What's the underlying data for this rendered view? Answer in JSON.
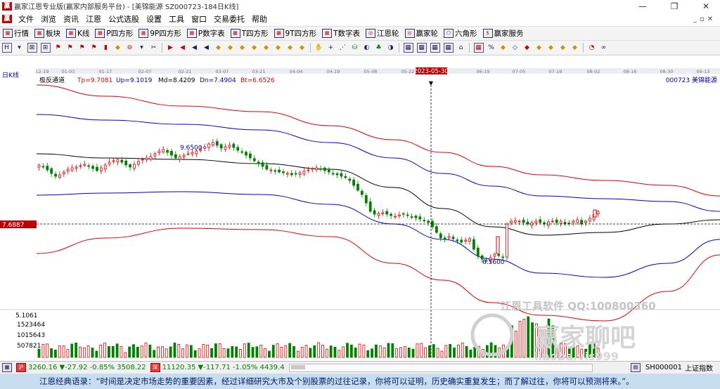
{
  "window": {
    "title": "赢家江恩专业版(赢家内部服务平台) - [美锦能源  SZ000723-184日K线]",
    "logo": "赢"
  },
  "menu": {
    "logo": "赢",
    "items": [
      "文件",
      "浏览",
      "资讯",
      "江恩",
      "公式选股",
      "设置",
      "工具",
      "窗口",
      "交易委托",
      "帮助"
    ]
  },
  "toolbar1": {
    "items": [
      {
        "label": "行情",
        "icon": "grid-icon"
      },
      {
        "label": "板块",
        "icon": "grid-icon"
      },
      {
        "label": "K线",
        "icon": "candle-icon"
      },
      {
        "label": "P四方形",
        "icon": "square-icon"
      },
      {
        "label": "9P四方形",
        "icon": "square-icon"
      },
      {
        "label": "P数字表",
        "icon": "square-icon"
      },
      {
        "label": "T四方形",
        "icon": "square-icon"
      },
      {
        "label": "9T四方形",
        "icon": "square-icon"
      },
      {
        "label": "T数字表",
        "icon": "square-icon"
      },
      {
        "label": "江恩轮",
        "icon": "wheel-icon"
      },
      {
        "label": "赢家轮",
        "icon": "wheel-icon"
      },
      {
        "label": "六角形",
        "icon": "hexagon-icon"
      },
      {
        "label": "赢家服务",
        "icon": "dollar-icon"
      }
    ]
  },
  "chart": {
    "period_label": "日K线",
    "indicator_name": "极反通道",
    "indicator_values": [
      {
        "label": "Tp=9.7081",
        "color": "#e00000"
      },
      {
        "label": "Up=9.1019",
        "color": "#0000d0"
      },
      {
        "label": "Md=8.4209",
        "color": "#000000"
      },
      {
        "label": "Dn=7.4904",
        "color": "#0000d0"
      },
      {
        "label": "Bt=6.6526",
        "color": "#e00000"
      }
    ],
    "stock": "000723 美锦能源",
    "date_ticks": [
      "12-19",
      "01-03",
      "01-17",
      "02-07",
      "02-21",
      "03-07",
      "03-21",
      "04-04",
      "04-19",
      "05-08",
      "05-22",
      "06-05",
      "06-19",
      "07-05",
      "07-19",
      "08-02",
      "08-16",
      "08-30",
      "09-13"
    ],
    "cursor_date": "2023-05-30",
    "cursor_price": "7.6887",
    "high_label": "9.6500",
    "low_label": "6.5600",
    "vol_top_label": "5.1061",
    "vol_labels": [
      "1523464",
      "1015643",
      "507821"
    ],
    "watermark_line": "江恩工具软件 QQ:100800360",
    "watermark_brand": "赢家聊吧",
    "watermark_url": "liaoba.yjs999"
  },
  "status": {
    "sh_index": "3260.16",
    "sh_change": "▼-27.92",
    "sh_pct": "-0.85%",
    "sh_amount": "3508.22",
    "sz_index": "11120.35",
    "sz_change": "▼-117.71",
    "sz_pct": "-1.05%",
    "sz_amount": "4439.4",
    "right_code": "SH000001",
    "right_name": "上证指数"
  },
  "ticker": {
    "text": "江恩经典语录：“时间是决定市场走势的重要因素，经过详细研究大市及个别股票的过往记录，你将可以证明，历史确实重复发生；而了解过往，你将可以预测将来。”。"
  }
}
